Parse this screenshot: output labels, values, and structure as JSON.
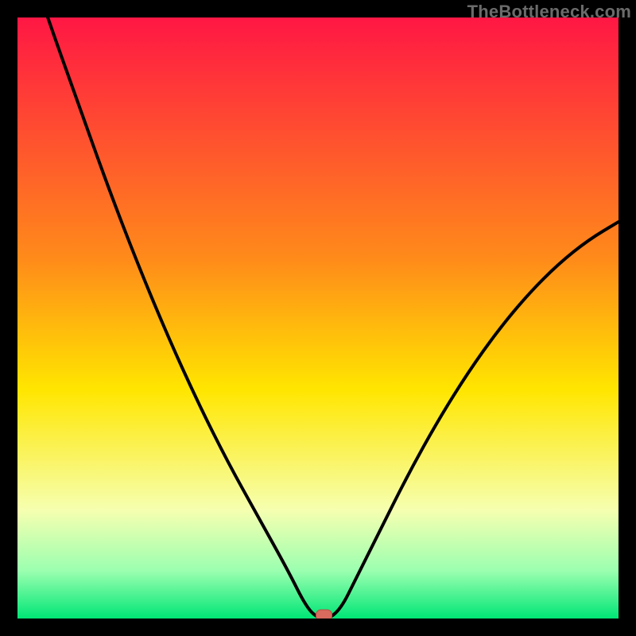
{
  "watermark": "TheBottleneck.com",
  "colors": {
    "frame": "#000000",
    "gradient_top": "#ff1744",
    "gradient_mid_upper": "#ff8a1a",
    "gradient_mid": "#ffe600",
    "gradient_mid_lower": "#f6ffb0",
    "gradient_low": "#9cffb0",
    "gradient_bottom": "#00e676",
    "curve": "#000000",
    "marker_fill": "#d86a5e",
    "marker_stroke": "#b94e42"
  },
  "chart_data": {
    "type": "line",
    "title": "",
    "xlabel": "",
    "ylabel": "",
    "xlim": [
      0,
      100
    ],
    "ylim": [
      0,
      100
    ],
    "series": [
      {
        "name": "bottleneck-curve",
        "x": [
          0,
          5,
          10,
          15,
          20,
          25,
          30,
          35,
          40,
          45,
          48,
          50,
          52,
          54,
          56,
          60,
          65,
          70,
          75,
          80,
          85,
          90,
          95,
          100
        ],
        "y": [
          115,
          100,
          86,
          72,
          59,
          47,
          36,
          26,
          17,
          8,
          2,
          0,
          0,
          2,
          6,
          14,
          24,
          33,
          41,
          48,
          54,
          59,
          63,
          66
        ]
      }
    ],
    "marker": {
      "x": 51,
      "y": 0
    },
    "gradient_stops": [
      {
        "offset": 0.0,
        "color": "#ff1744"
      },
      {
        "offset": 0.4,
        "color": "#ff8a1a"
      },
      {
        "offset": 0.62,
        "color": "#ffe600"
      },
      {
        "offset": 0.82,
        "color": "#f6ffb0"
      },
      {
        "offset": 0.92,
        "color": "#9cffb0"
      },
      {
        "offset": 1.0,
        "color": "#00e676"
      }
    ]
  }
}
